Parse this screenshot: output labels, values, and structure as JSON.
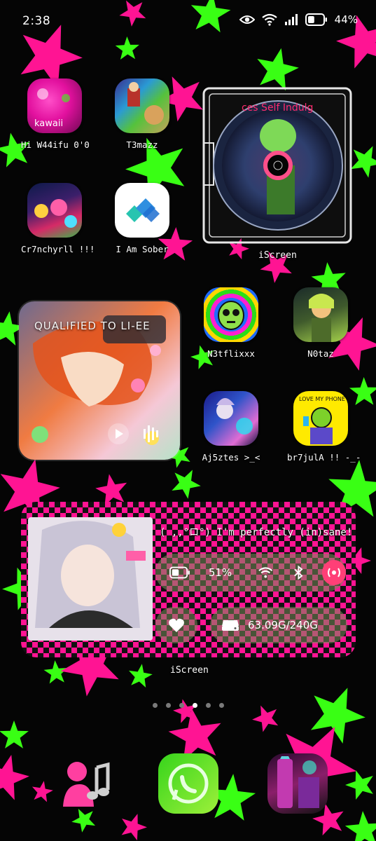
{
  "status_bar": {
    "time": "2:38",
    "battery_percent": "44%",
    "battery_level": 0.44
  },
  "home": {
    "apps": [
      {
        "name": "hi-waifu-app",
        "label": "Hi W44ifu 0'0",
        "colors": [
          "#e2109e",
          "#8b0c68"
        ]
      },
      {
        "name": "t3mazz-app",
        "label": "T3mazz",
        "colors": [
          "#3a2d8f",
          "#c7a15a"
        ]
      },
      {
        "name": "cr7nchyrll-app",
        "label": "Cr7nchyrll !!!",
        "colors": [
          "#0d1a4a",
          "#d62a67"
        ]
      },
      {
        "name": "i-am-sober-app",
        "label": "I Am Sober",
        "colors": [
          "#ffffff",
          "#2fb8a3"
        ]
      },
      {
        "name": "n3tflixxx-app",
        "label": "N3tflixxx",
        "colors": [
          "#2bdc19",
          "#e21bd2"
        ]
      },
      {
        "name": "n0taz-app",
        "label": "N0taz",
        "colors": [
          "#1b2b2a",
          "#a6d34b"
        ]
      },
      {
        "name": "aj5ztes-app",
        "label": "Aj5ztes >_<",
        "colors": [
          "#1b1b8a",
          "#e06cd4"
        ]
      },
      {
        "name": "br7julA-app",
        "label": "br7julA !! -_-",
        "colors": [
          "#ffea00",
          "#7dd12a"
        ]
      }
    ],
    "widgets": {
      "cd_label": "iScreen",
      "photo_title": "QUALIFIED TO LI-EE",
      "status_widget": {
        "caption": "( ,,°ロ°) I'm perfectly (in)sane!",
        "battery": "51%",
        "battery_level": 0.51,
        "storage": "63.09G/240G",
        "label": "iScreen"
      }
    },
    "page_dots": 6,
    "active_page": 3
  },
  "dock": [
    {
      "name": "messenger-app"
    },
    {
      "name": "whatsapp-app"
    },
    {
      "name": "gallery-app"
    }
  ],
  "colors": {
    "pink": "#ff1493",
    "green": "#39ff14",
    "background": "#050505"
  }
}
